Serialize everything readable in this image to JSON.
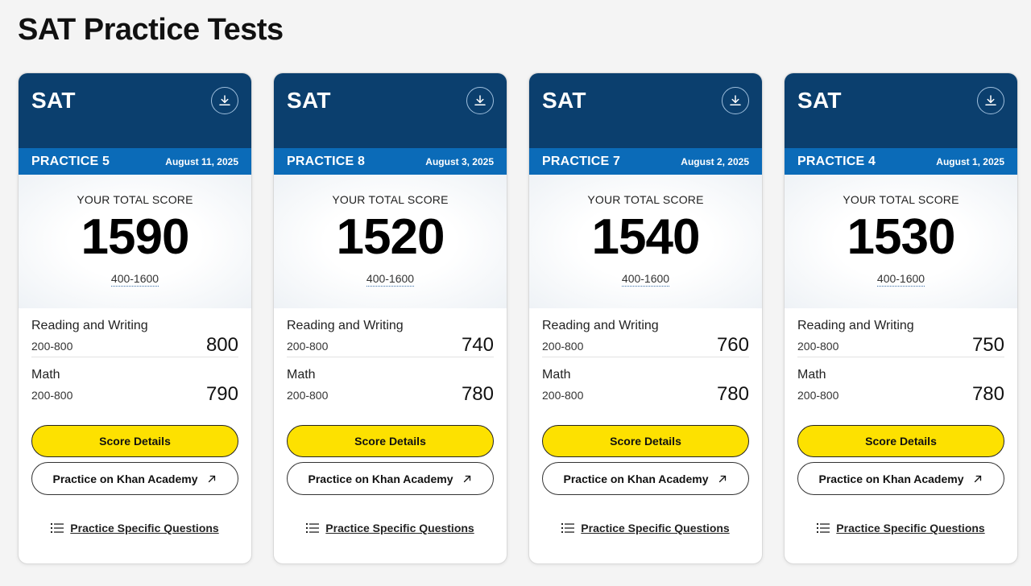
{
  "page": {
    "title": "SAT Practice Tests"
  },
  "colors": {
    "header": "#0b3f6e",
    "band": "#0b6bb8",
    "primary_button": "#fde100"
  },
  "icons": {
    "download": "download-icon",
    "external": "arrow-up-right-icon",
    "list": "list-icon"
  },
  "cards": [
    {
      "brand": "SAT",
      "practice": "PRACTICE 5",
      "date": "August 11, 2025",
      "score_caption": "YOUR TOTAL SCORE",
      "total": "1590",
      "total_range": "400-1600",
      "sections": [
        {
          "name": "Reading and Writing",
          "range": "200-800",
          "score": "800"
        },
        {
          "name": "Math",
          "range": "200-800",
          "score": "790"
        }
      ],
      "primary_button": "Score Details",
      "secondary_button": "Practice on Khan Academy",
      "link": "Practice Specific Questions"
    },
    {
      "brand": "SAT",
      "practice": "PRACTICE 8",
      "date": "August 3, 2025",
      "score_caption": "YOUR TOTAL SCORE",
      "total": "1520",
      "total_range": "400-1600",
      "sections": [
        {
          "name": "Reading and Writing",
          "range": "200-800",
          "score": "740"
        },
        {
          "name": "Math",
          "range": "200-800",
          "score": "780"
        }
      ],
      "primary_button": "Score Details",
      "secondary_button": "Practice on Khan Academy",
      "link": "Practice Specific Questions"
    },
    {
      "brand": "SAT",
      "practice": "PRACTICE 7",
      "date": "August 2, 2025",
      "score_caption": "YOUR TOTAL SCORE",
      "total": "1540",
      "total_range": "400-1600",
      "sections": [
        {
          "name": "Reading and Writing",
          "range": "200-800",
          "score": "760"
        },
        {
          "name": "Math",
          "range": "200-800",
          "score": "780"
        }
      ],
      "primary_button": "Score Details",
      "secondary_button": "Practice on Khan Academy",
      "link": "Practice Specific Questions"
    },
    {
      "brand": "SAT",
      "practice": "PRACTICE 4",
      "date": "August 1, 2025",
      "score_caption": "YOUR TOTAL SCORE",
      "total": "1530",
      "total_range": "400-1600",
      "sections": [
        {
          "name": "Reading and Writing",
          "range": "200-800",
          "score": "750"
        },
        {
          "name": "Math",
          "range": "200-800",
          "score": "780"
        }
      ],
      "primary_button": "Score Details",
      "secondary_button": "Practice on Khan Academy",
      "link": "Practice Specific Questions"
    }
  ]
}
